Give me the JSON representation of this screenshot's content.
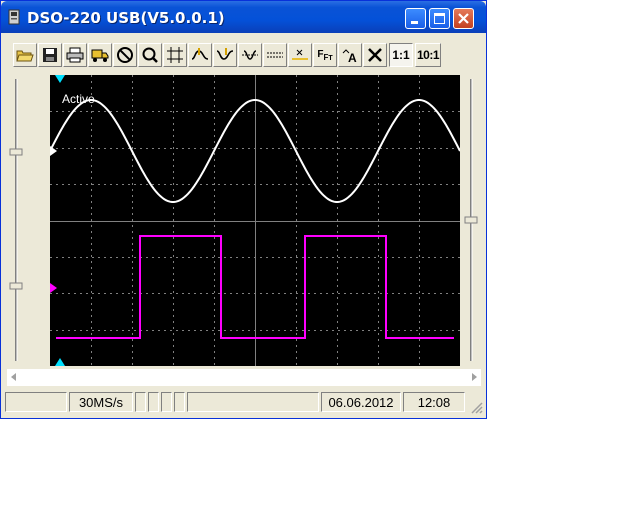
{
  "window": {
    "title": "DSO-220 USB(V5.0.0.1)"
  },
  "toolbar": {
    "ratio_1_label": "1:1",
    "ratio_10_label": "10:1",
    "fft_label": "F",
    "icons": [
      "folder-open-icon",
      "save-icon",
      "print-icon",
      "truck-icon",
      "stop-icon",
      "zoom-icon",
      "crosshair-icon",
      "rising-edge-icon",
      "falling-edge-icon",
      "trigger-level-icon",
      "dash-line-icon",
      "cursor-x-icon",
      "fft-icon",
      "auto-icon",
      "close-x-icon"
    ]
  },
  "scope": {
    "status_label": "Active",
    "channel1_color": "#ffffff",
    "channel2_color": "#ff00ff",
    "grid_color": "#808080"
  },
  "status": {
    "sample_rate": "30MS/s",
    "date": "06.06.2012",
    "time": "12:08"
  }
}
